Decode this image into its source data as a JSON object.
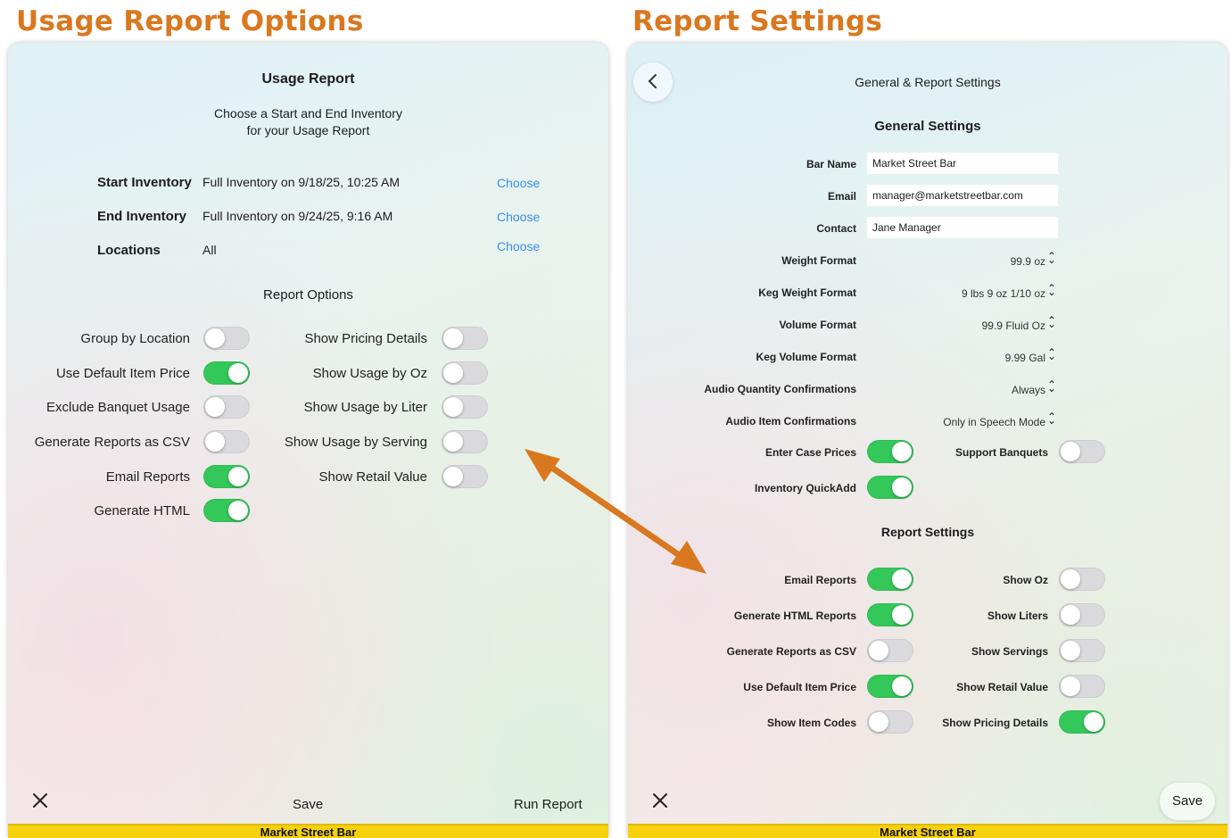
{
  "left_heading": "Usage Report Options",
  "right_heading": "Report Settings",
  "left": {
    "title": "Usage Report",
    "subtitle_line1": "Choose a Start and End Inventory",
    "subtitle_line2": "for your Usage Report",
    "rows": [
      {
        "label": "Start Inventory",
        "value": "Full Inventory on 9/18/25, 10:25 AM",
        "action": "Choose"
      },
      {
        "label": "End Inventory",
        "value": "Full Inventory on 9/24/25, 9:16 AM",
        "action": "Choose"
      },
      {
        "label": "Locations",
        "value": "All",
        "action": "Choose"
      }
    ],
    "options_header": "Report Options",
    "left_toggles": [
      {
        "label": "Group by Location",
        "on": false
      },
      {
        "label": "Use Default Item Price",
        "on": true
      },
      {
        "label": "Exclude Banquet Usage",
        "on": false
      },
      {
        "label": "Generate Reports as CSV",
        "on": false
      },
      {
        "label": "Email Reports",
        "on": true
      },
      {
        "label": "Generate HTML",
        "on": true
      }
    ],
    "right_toggles": [
      {
        "label": "Show Pricing Details",
        "on": false
      },
      {
        "label": "Show Usage by Oz",
        "on": false
      },
      {
        "label": "Show Usage by Liter",
        "on": false
      },
      {
        "label": "Show Usage by Serving",
        "on": false
      },
      {
        "label": "Show Retail Value",
        "on": false
      }
    ],
    "close_icon": "close-icon",
    "save_label": "Save",
    "run_label": "Run Report",
    "footer": "Market Street Bar"
  },
  "right": {
    "title": "General & Report Settings",
    "general_header": "General Settings",
    "fields": [
      {
        "label": "Bar Name",
        "value": "Market Street Bar"
      },
      {
        "label": "Email",
        "value": "manager@marketstreetbar.com"
      },
      {
        "label": "Contact",
        "value": "Jane Manager"
      }
    ],
    "formats": [
      {
        "label": "Weight Format",
        "value": "99.9 oz"
      },
      {
        "label": "Keg Weight Format",
        "value": "9 lbs 9 oz 1/10 oz"
      },
      {
        "label": "Volume Format",
        "value": "99.9 Fluid Oz"
      },
      {
        "label": "Keg Volume Format",
        "value": "9.99 Gal"
      },
      {
        "label": "Audio Quantity Confirmations",
        "value": "Always"
      },
      {
        "label": "Audio Item Confirmations",
        "value": "Only in Speech Mode"
      }
    ],
    "general_toggles": [
      {
        "label": "Enter Case Prices",
        "on": true
      },
      {
        "label": "Support Banquets",
        "on": false
      },
      {
        "label": "Inventory QuickAdd",
        "on": true
      }
    ],
    "report_header": "Report Settings",
    "report_left": [
      {
        "label": "Email Reports",
        "on": true
      },
      {
        "label": "Generate HTML Reports",
        "on": true
      },
      {
        "label": "Generate Reports as CSV",
        "on": false
      },
      {
        "label": "Use Default Item Price",
        "on": true
      },
      {
        "label": "Show Item Codes",
        "on": false
      }
    ],
    "report_right": [
      {
        "label": "Show Oz",
        "on": false
      },
      {
        "label": "Show Liters",
        "on": false
      },
      {
        "label": "Show Servings",
        "on": false
      },
      {
        "label": "Show Retail Value",
        "on": false
      },
      {
        "label": "Show Pricing Details",
        "on": true
      }
    ],
    "back_icon": "chevron-left-icon",
    "close_icon": "close-icon",
    "save_label": "Save",
    "footer": "Market Street Bar"
  },
  "arrow_color": "#d9781f",
  "accent_color": "#d9781f",
  "toggle_on_color": "#34c759",
  "footer_color": "#f6d10e"
}
